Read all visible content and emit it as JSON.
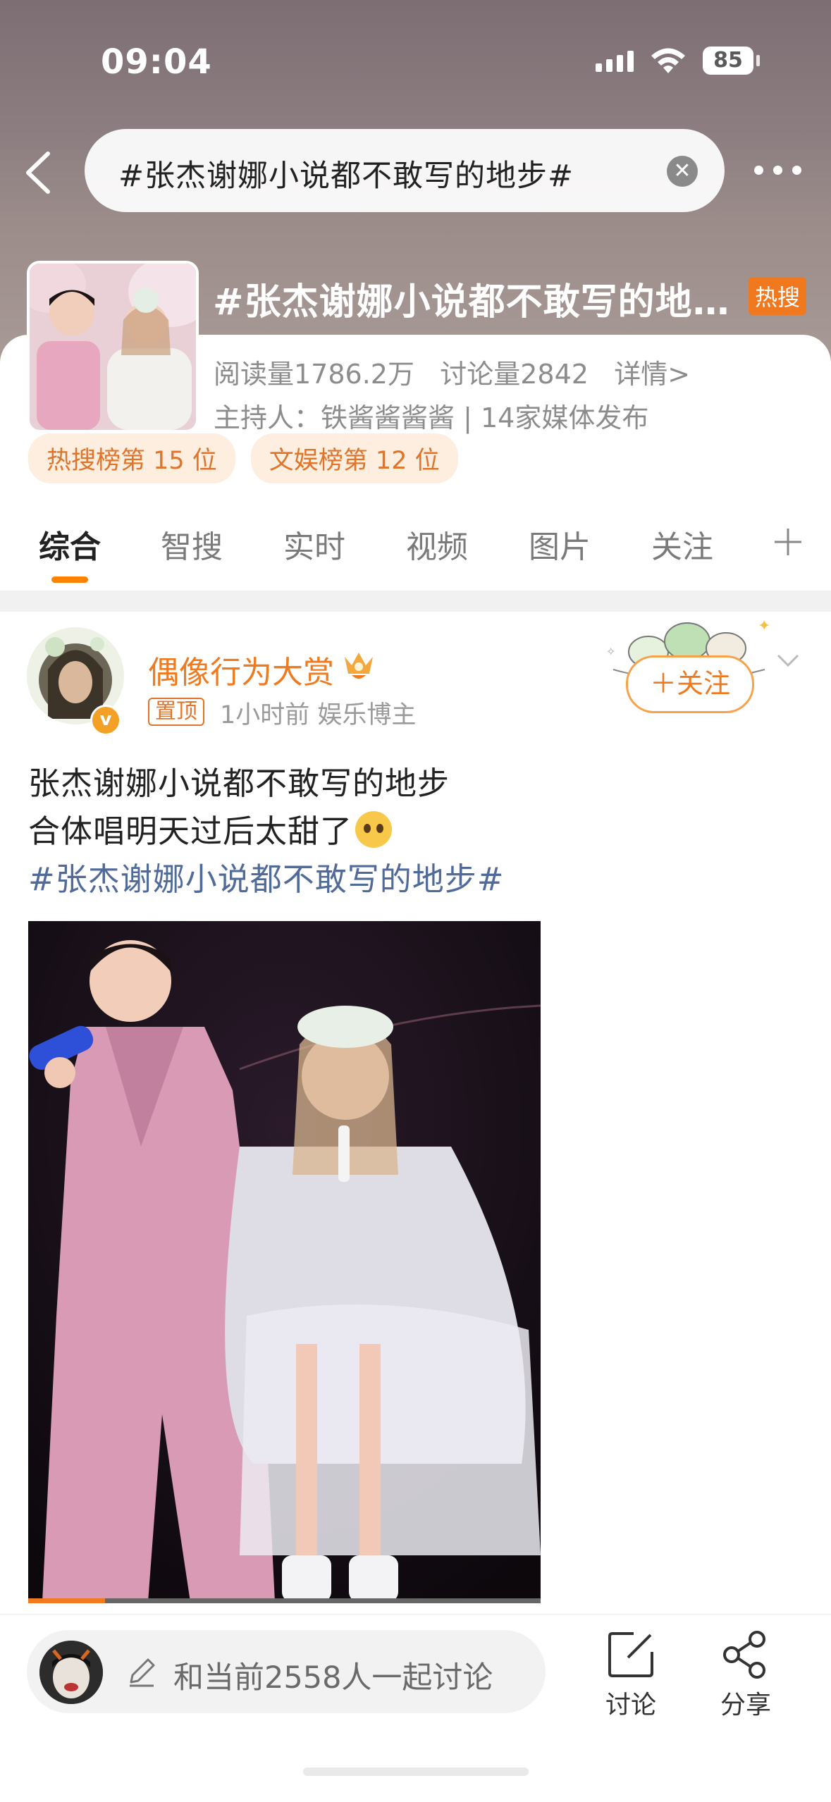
{
  "status_bar": {
    "time": "09:04",
    "battery": "85"
  },
  "search": {
    "query": "#张杰谢娜小说都不敢写的地步#"
  },
  "topic": {
    "title": "#张杰谢娜小说都不敢写的地步#",
    "badge": "热搜",
    "reads": "阅读量1786.2万",
    "discussions": "讨论量2842",
    "details": "详情>",
    "host": "主持人：铁酱酱酱酱 | 14家媒体发布",
    "chips": [
      "热搜榜第 15 位",
      "文娱榜第 12 位"
    ]
  },
  "tabs": [
    "综合",
    "智搜",
    "实时",
    "视频",
    "图片",
    "关注"
  ],
  "post": {
    "author": "偶像行为大赏",
    "pinned": "置顶",
    "meta": "1小时前  娱乐博主",
    "follow_label": "＋关注",
    "line1": "张杰谢娜小说都不敢写的地步",
    "line2": "合体唱明天过后太甜了",
    "hashtag": "#张杰谢娜小说都不敢写的地步#",
    "video_progress": 0.15
  },
  "bottom_bar": {
    "compose_placeholder": "和当前2558人一起讨论",
    "discuss_label": "讨论",
    "share_label": "分享"
  },
  "colors": {
    "accent": "#ff8200",
    "hashtag": "#506a99",
    "username": "#f07a1f"
  }
}
